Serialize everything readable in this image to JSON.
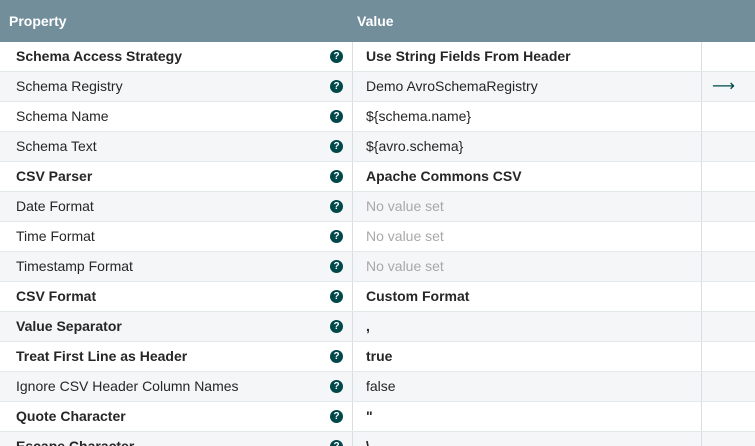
{
  "header": {
    "property_label": "Property",
    "value_label": "Value"
  },
  "help_glyph": "?",
  "action_glyph": "⟶",
  "colors": {
    "header_bg": "#728e9b",
    "help_icon": "#004849",
    "unset_text": "#a8a8a8"
  },
  "rows": [
    {
      "name": "Schema Access Strategy",
      "value": "Use String Fields From Header",
      "required": true,
      "unset": false,
      "action": false
    },
    {
      "name": "Schema Registry",
      "value": "Demo AvroSchemaRegistry",
      "required": false,
      "unset": false,
      "action": true
    },
    {
      "name": "Schema Name",
      "value": "${schema.name}",
      "required": false,
      "unset": false,
      "action": false
    },
    {
      "name": "Schema Text",
      "value": "${avro.schema}",
      "required": false,
      "unset": false,
      "action": false
    },
    {
      "name": "CSV Parser",
      "value": "Apache Commons CSV",
      "required": true,
      "unset": false,
      "action": false
    },
    {
      "name": "Date Format",
      "value": "No value set",
      "required": false,
      "unset": true,
      "action": false
    },
    {
      "name": "Time Format",
      "value": "No value set",
      "required": false,
      "unset": true,
      "action": false
    },
    {
      "name": "Timestamp Format",
      "value": "No value set",
      "required": false,
      "unset": true,
      "action": false
    },
    {
      "name": "CSV Format",
      "value": "Custom Format",
      "required": true,
      "unset": false,
      "action": false
    },
    {
      "name": "Value Separator",
      "value": ",",
      "required": true,
      "unset": false,
      "action": false
    },
    {
      "name": "Treat First Line as Header",
      "value": "true",
      "required": true,
      "unset": false,
      "action": false
    },
    {
      "name": "Ignore CSV Header Column Names",
      "value": "false",
      "required": false,
      "unset": false,
      "action": false
    },
    {
      "name": "Quote Character",
      "value": "\"",
      "required": true,
      "unset": false,
      "action": false
    },
    {
      "name": "Escape Character",
      "value": "\\",
      "required": true,
      "unset": false,
      "action": false
    }
  ]
}
